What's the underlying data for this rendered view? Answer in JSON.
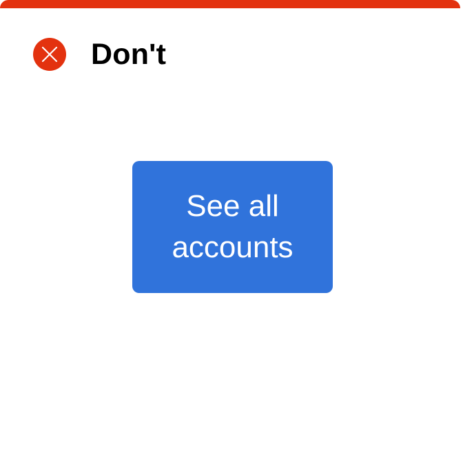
{
  "colors": {
    "dont_red": "#E3320F",
    "button_blue": "#3073DB"
  },
  "header": {
    "icon": "close-circle-icon",
    "label": "Don't"
  },
  "cta": {
    "label": "See all accounts"
  }
}
